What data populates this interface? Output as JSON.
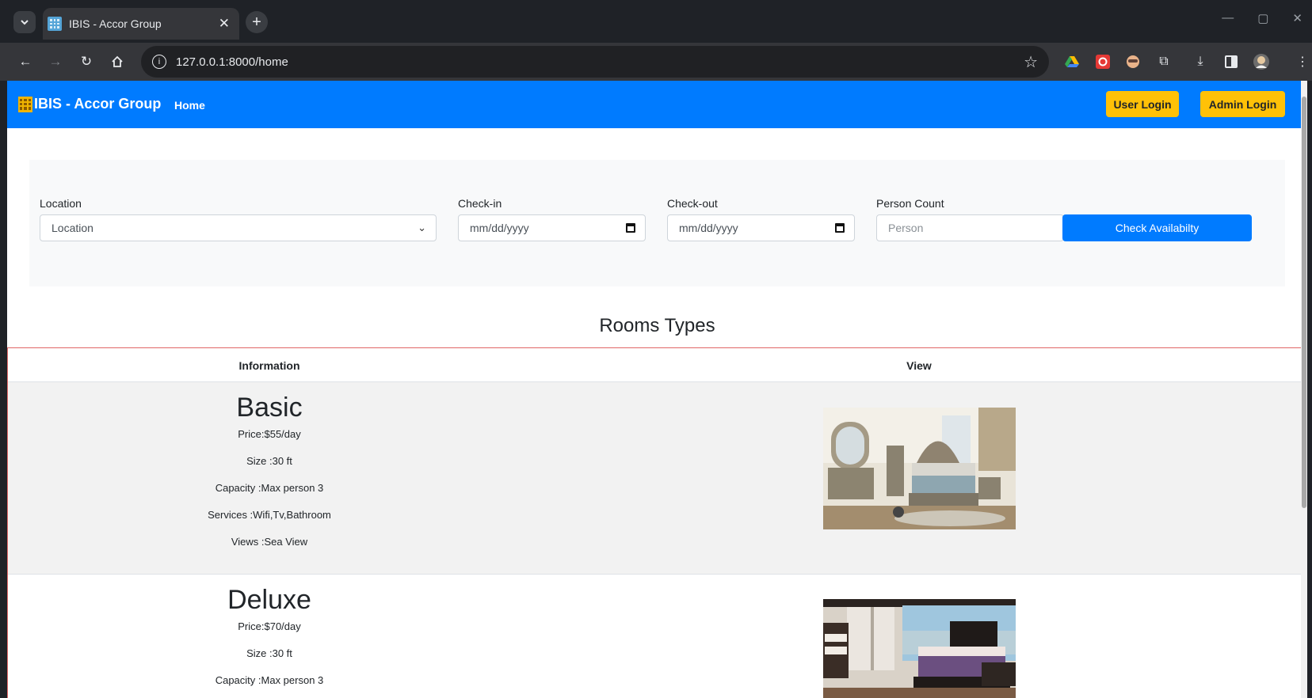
{
  "browser": {
    "tab_title": "IBIS - Accor Group",
    "url": "127.0.0.1:8000/home"
  },
  "navbar": {
    "brand": "IBIS - Accor Group",
    "home": "Home",
    "user_login": "User Login",
    "admin_login": "Admin Login",
    "color": "#007bff",
    "button_color": "#ffc107"
  },
  "search": {
    "location_label": "Location",
    "location_value": "Location",
    "checkin_label": "Check-in",
    "checkin_placeholder": "mm/dd/yyyy",
    "checkout_label": "Check-out",
    "checkout_placeholder": "mm/dd/yyyy",
    "person_label": "Person Count",
    "person_placeholder": "Person",
    "button": "Check Availabilty"
  },
  "rooms": {
    "title": "Rooms Types",
    "headers": {
      "information": "Information",
      "view": "View"
    },
    "items": [
      {
        "name": "Basic",
        "price": "Price:$55/day",
        "size": "Size :30 ft",
        "capacity": "Capacity :Max person 3",
        "services": "Services :Wifi,Tv,Bathroom",
        "views": "Views :Sea View"
      },
      {
        "name": "Deluxe",
        "price": "Price:$70/day",
        "size": "Size :30 ft",
        "capacity": "Capacity :Max person 3"
      }
    ]
  }
}
